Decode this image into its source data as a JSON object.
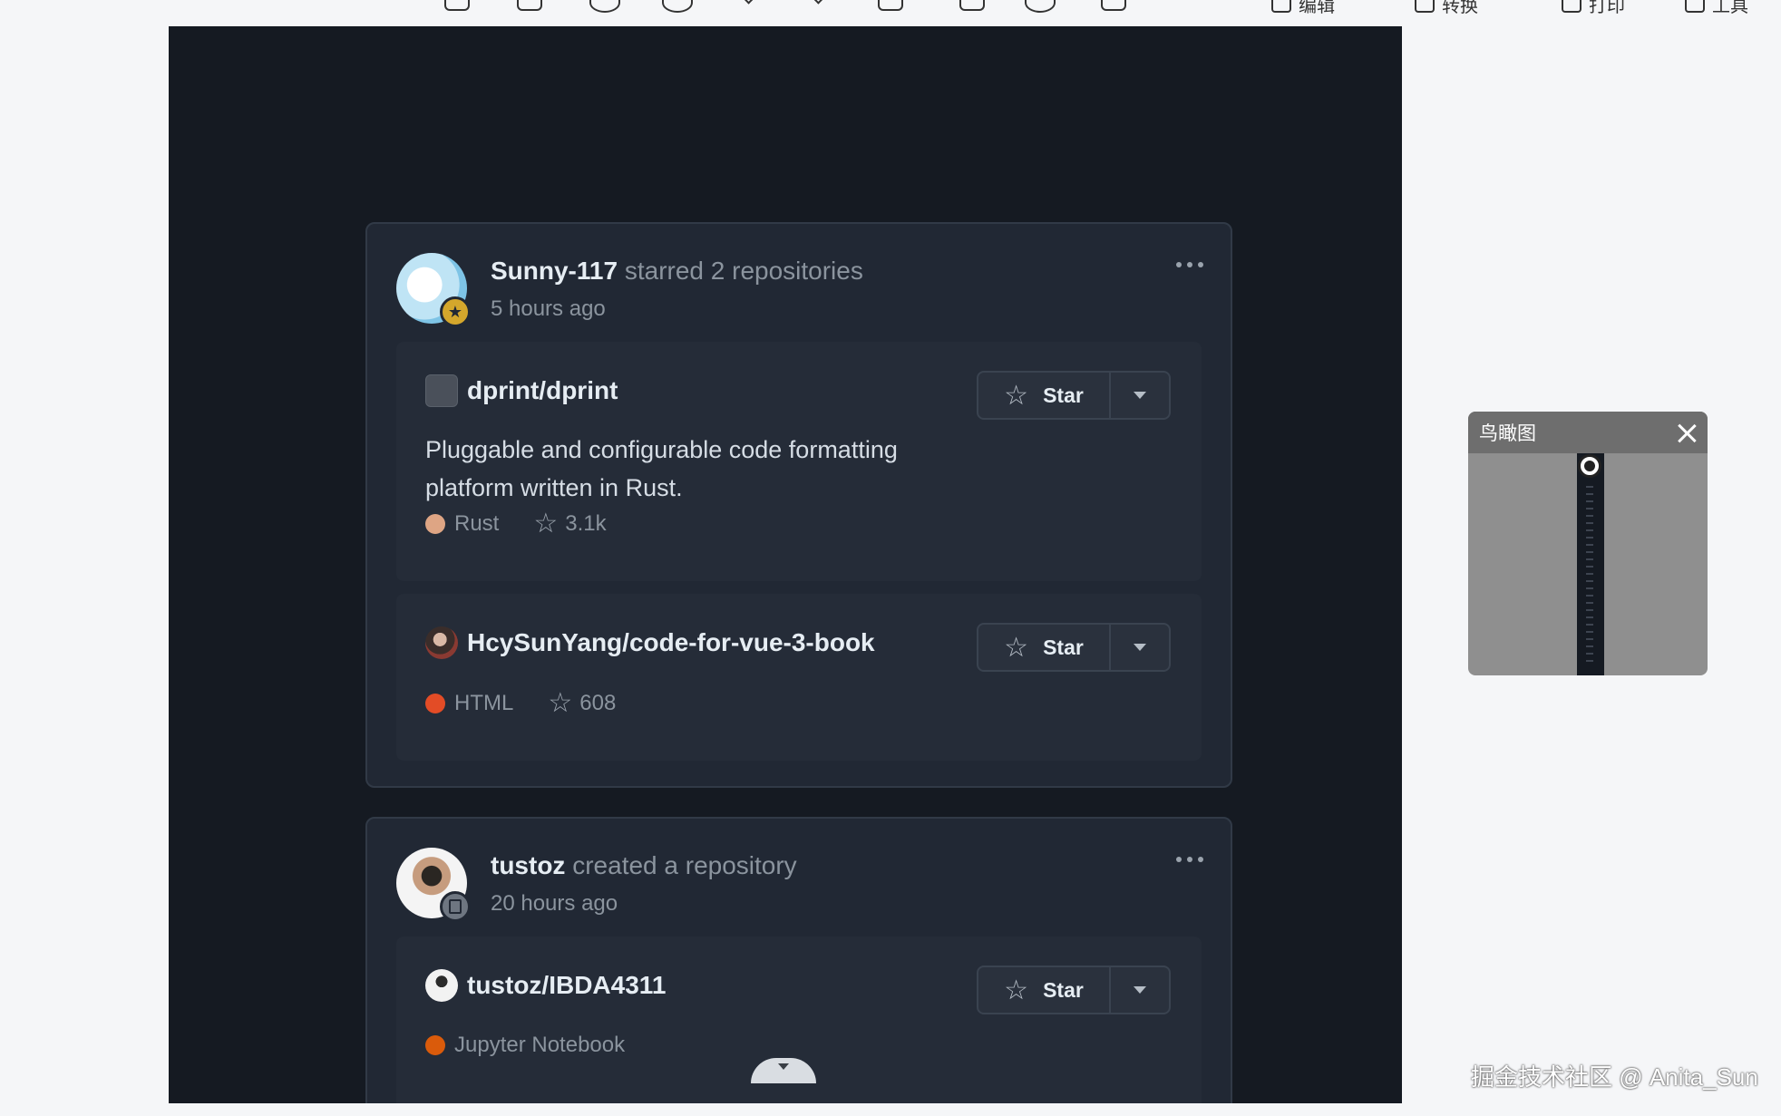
{
  "toolbar": {
    "actions": [
      {
        "label": "编辑",
        "icon": "edit-icon"
      },
      {
        "label": "转换",
        "icon": "convert-icon"
      },
      {
        "label": "打印",
        "icon": "print-icon"
      },
      {
        "label": "工具",
        "icon": "tools-icon"
      }
    ]
  },
  "feed": [
    {
      "user": "Sunny-117",
      "action": "starred 2 repositories",
      "time": "5 hours ago",
      "badge_icon": "star-icon",
      "repos": [
        {
          "name": "dprint/dprint",
          "description": "Pluggable and configurable code formatting platform written in Rust.",
          "language": "Rust",
          "language_color": "#dea584",
          "stars": "3.1k",
          "star_button": "Star"
        },
        {
          "name": "HcySunYang/code-for-vue-3-book",
          "description": "",
          "language": "HTML",
          "language_color": "#e34c26",
          "stars": "608",
          "star_button": "Star"
        }
      ]
    },
    {
      "user": "tustoz",
      "action": "created a repository",
      "time": "20 hours ago",
      "badge_icon": "repo-icon",
      "repos": [
        {
          "name": "tustoz/IBDA4311",
          "language": "Jupyter Notebook",
          "language_color": "#DA5B0B",
          "star_button": "Star"
        }
      ]
    }
  ],
  "birdseye": {
    "title": "鸟瞰图"
  },
  "watermark": "掘金技术社区 @ Anita_Sun"
}
